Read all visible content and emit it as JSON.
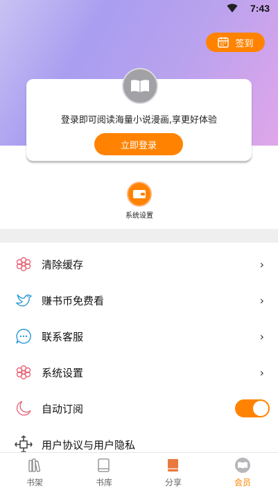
{
  "status_bar": {
    "time": "7:43"
  },
  "header": {
    "checkin_label": "签到"
  },
  "login_card": {
    "tip": "登录即可阅读海量小说漫画,享更好体验",
    "login_button": "立即登录"
  },
  "shortcut": {
    "label": "系统设置"
  },
  "menu": {
    "items": [
      {
        "label": "清除缓存",
        "icon": "flower-icon"
      },
      {
        "label": "赚书币免费看",
        "icon": "bird-icon"
      },
      {
        "label": "联系客服",
        "icon": "chat-icon"
      },
      {
        "label": "系统设置",
        "icon": "flower-icon"
      },
      {
        "label": "自动订阅",
        "icon": "moon-icon",
        "toggle": true
      },
      {
        "label": "用户协议与用户隐私",
        "icon": "expand-icon"
      }
    ]
  },
  "tabs": [
    {
      "label": "书架",
      "icon": "bookshelf-icon",
      "active": false
    },
    {
      "label": "书库",
      "icon": "library-icon",
      "active": false
    },
    {
      "label": "分享",
      "icon": "share-book-icon",
      "active": false
    },
    {
      "label": "会员",
      "icon": "member-icon",
      "active": true
    }
  ],
  "colors": {
    "accent": "#ff8300",
    "gradient_start": "#c9c2f3",
    "gradient_end": "#e0a6ea"
  }
}
